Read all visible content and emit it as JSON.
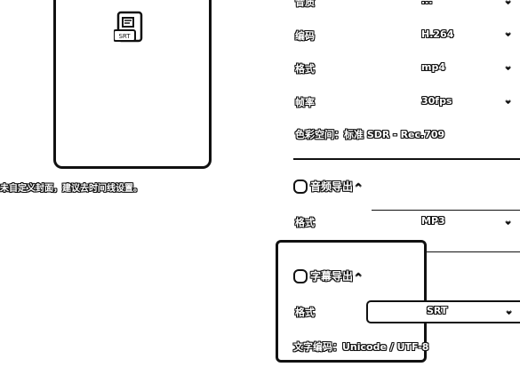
{
  "preview": {
    "file_icon_label": "SRT",
    "cover_hint": "未自定义封面，建议去时间线设置。"
  },
  "video": {
    "rows": [
      {
        "label": "音质",
        "value": "..."
      },
      {
        "label": "编码",
        "value": "H.264"
      },
      {
        "label": "格式",
        "value": "mp4"
      },
      {
        "label": "帧率",
        "value": "30fps"
      }
    ],
    "color_space": "色彩空间：标准 SDR - Rec.709"
  },
  "audio_export": {
    "title": "音频导出",
    "format_label": "格式",
    "format_value": "MP3"
  },
  "subtitle_export": {
    "title": "字幕导出",
    "format_label": "格式",
    "format_value": "SRT",
    "encoding": "文字编码：Unicode / UTF-8"
  }
}
